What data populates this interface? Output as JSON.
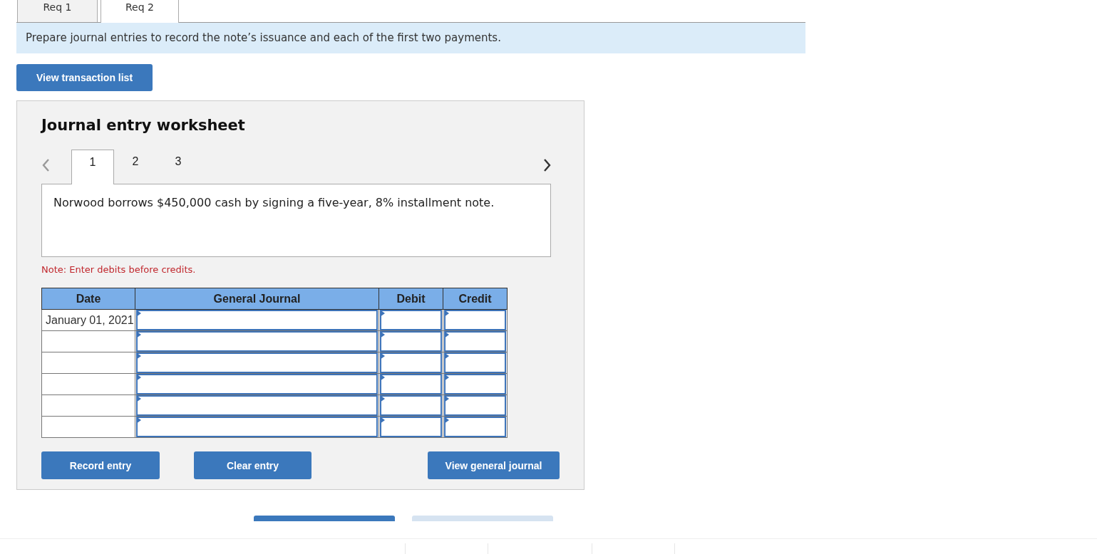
{
  "req_tabs": [
    {
      "label": "Req 1",
      "selected": false
    },
    {
      "label": "Req 2",
      "selected": true
    }
  ],
  "instruction": "Prepare journal entries to record the note’s issuance and each of the first two payments.",
  "view_transaction_button": "View transaction list",
  "worksheet": {
    "title": "Journal entry worksheet",
    "prev_enabled": false,
    "next_enabled": true,
    "steps": [
      {
        "label": "1",
        "selected": true
      },
      {
        "label": "2",
        "selected": false
      },
      {
        "label": "3",
        "selected": false
      }
    ],
    "transaction": "Norwood borrows $450,000 cash by signing a five-year, 8% installment note.",
    "note": "Note: Enter debits before credits.",
    "table": {
      "columns": [
        "Date",
        "General Journal",
        "Debit",
        "Credit"
      ],
      "rows": [
        {
          "date": "January 01, 2021"
        },
        {},
        {},
        {},
        {},
        {}
      ]
    },
    "buttons": [
      "Record entry",
      "Clear entry",
      "View general journal"
    ]
  },
  "bottom_buttons": [
    {
      "selected": true
    },
    {
      "selected": false
    }
  ]
}
